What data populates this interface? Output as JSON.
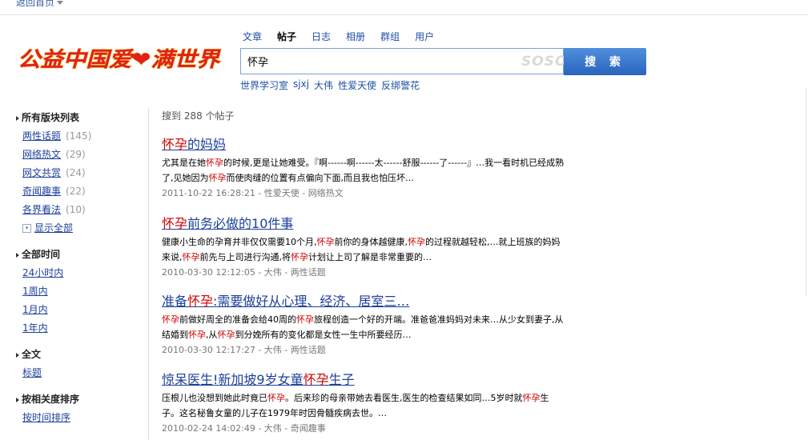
{
  "topbar": {
    "back_label": "返回首页"
  },
  "logo": {
    "text": "公益中国爱❤满世界",
    "color": "#e0201c"
  },
  "search": {
    "tabs": [
      {
        "label": "文章",
        "active": false
      },
      {
        "label": "帖子",
        "active": true
      },
      {
        "label": "日志",
        "active": false
      },
      {
        "label": "相册",
        "active": false
      },
      {
        "label": "群组",
        "active": false
      },
      {
        "label": "用户",
        "active": false
      }
    ],
    "query": "怀孕",
    "watermark": "SOSO",
    "button_label": "搜 索",
    "suggestions": [
      "世界学习室",
      "sjxj",
      "大伟",
      "性爱天使",
      "反绑警花"
    ]
  },
  "sidebar": {
    "sections": [
      {
        "title": "所有版块列表",
        "items": [
          {
            "label": "两性话题",
            "count": "(145)"
          },
          {
            "label": "网络热文",
            "count": "(29)"
          },
          {
            "label": "网文共赏",
            "count": "(24)"
          },
          {
            "label": "奇闻趣事",
            "count": "(22)"
          },
          {
            "label": "各界看法",
            "count": "(10)"
          }
        ],
        "show_all": "显示全部"
      },
      {
        "title": "全部时间",
        "items": [
          {
            "label": "24小时内"
          },
          {
            "label": "1周内"
          },
          {
            "label": "1月内"
          },
          {
            "label": "1年内"
          }
        ]
      },
      {
        "title": "全文",
        "items": [
          {
            "label": "标题"
          }
        ]
      },
      {
        "title": "按相关度排序",
        "items": [
          {
            "label": "按时间排序"
          }
        ]
      }
    ]
  },
  "results": {
    "count_text": "搜到  288 个帖子",
    "items": [
      {
        "title": [
          {
            "t": "怀孕",
            "h": true
          },
          {
            "t": "的妈妈",
            "h": false
          }
        ],
        "snippet": [
          [
            {
              "t": "尤其是在她",
              "h": false
            },
            {
              "t": "怀孕",
              "h": true
            },
            {
              "t": "的时候,更是让她难受。『啊------啊------太------舒服------了------』…我一看时机已经成熟",
              "h": false
            }
          ],
          [
            {
              "t": "了,见她因为",
              "h": false
            },
            {
              "t": "怀孕",
              "h": true
            },
            {
              "t": "而使肉缝的位置有点偏向下面,而且我也怕压坏…",
              "h": false
            }
          ]
        ],
        "meta": "2011-10-22 16:28:21 - 性爱天使  - 网络热文"
      },
      {
        "title": [
          {
            "t": "怀孕",
            "h": true
          },
          {
            "t": "前务必做的10件事",
            "h": false
          }
        ],
        "snippet": [
          [
            {
              "t": "健康小生命的孕育并非仅仅需要10个月,",
              "h": false
            },
            {
              "t": "怀孕",
              "h": true
            },
            {
              "t": "前你的身体越健康,",
              "h": false
            },
            {
              "t": "怀孕",
              "h": true
            },
            {
              "t": "的过程就越轻松,…就上班族的妈妈",
              "h": false
            }
          ],
          [
            {
              "t": "来说,",
              "h": false
            },
            {
              "t": "怀孕",
              "h": true
            },
            {
              "t": "前先与上司进行沟通,将",
              "h": false
            },
            {
              "t": "怀孕",
              "h": true
            },
            {
              "t": "计划让上司了解是非常重要的…",
              "h": false
            }
          ]
        ],
        "meta": "2010-03-30 12:12:05 - 大伟  - 两性话题"
      },
      {
        "title": [
          {
            "t": "准备",
            "h": false
          },
          {
            "t": "怀孕",
            "h": true
          },
          {
            "t": ":需要做好从心理、经济、居室三…",
            "h": false
          }
        ],
        "snippet": [
          [
            {
              "t": "怀孕",
              "h": true
            },
            {
              "t": "前做好周全的准备会给40周的",
              "h": false
            },
            {
              "t": "怀孕",
              "h": true
            },
            {
              "t": "旅程创造一个好的开端。准爸爸准妈妈对未来…从少女到妻子,从",
              "h": false
            }
          ],
          [
            {
              "t": "结婚到",
              "h": false
            },
            {
              "t": "怀孕",
              "h": true
            },
            {
              "t": ",从",
              "h": false
            },
            {
              "t": "怀孕",
              "h": true
            },
            {
              "t": "到分娩所有的变化都是女性一生中所要经历…",
              "h": false
            }
          ]
        ],
        "meta": "2010-03-30 12:17:27 - 大伟  - 两性话题"
      },
      {
        "title": [
          {
            "t": "惊呆医生!新加坡9岁女童",
            "h": false
          },
          {
            "t": "怀孕",
            "h": true
          },
          {
            "t": "生子",
            "h": false
          }
        ],
        "snippet": [
          [
            {
              "t": "压根儿也没想到她此时竟已",
              "h": false
            },
            {
              "t": "怀孕",
              "h": true
            },
            {
              "t": "。后来珍的母亲带她去看医生,医生的检查结果如同…5岁时就",
              "h": false
            },
            {
              "t": "怀孕",
              "h": true
            },
            {
              "t": "生",
              "h": false
            }
          ],
          [
            {
              "t": "子。这名秘鲁女童的儿子在1979年时因骨髓疾病去世。…",
              "h": false
            }
          ]
        ],
        "meta": "2010-02-24 14:02:49 - 大伟  - 奇闻趣事"
      }
    ]
  }
}
